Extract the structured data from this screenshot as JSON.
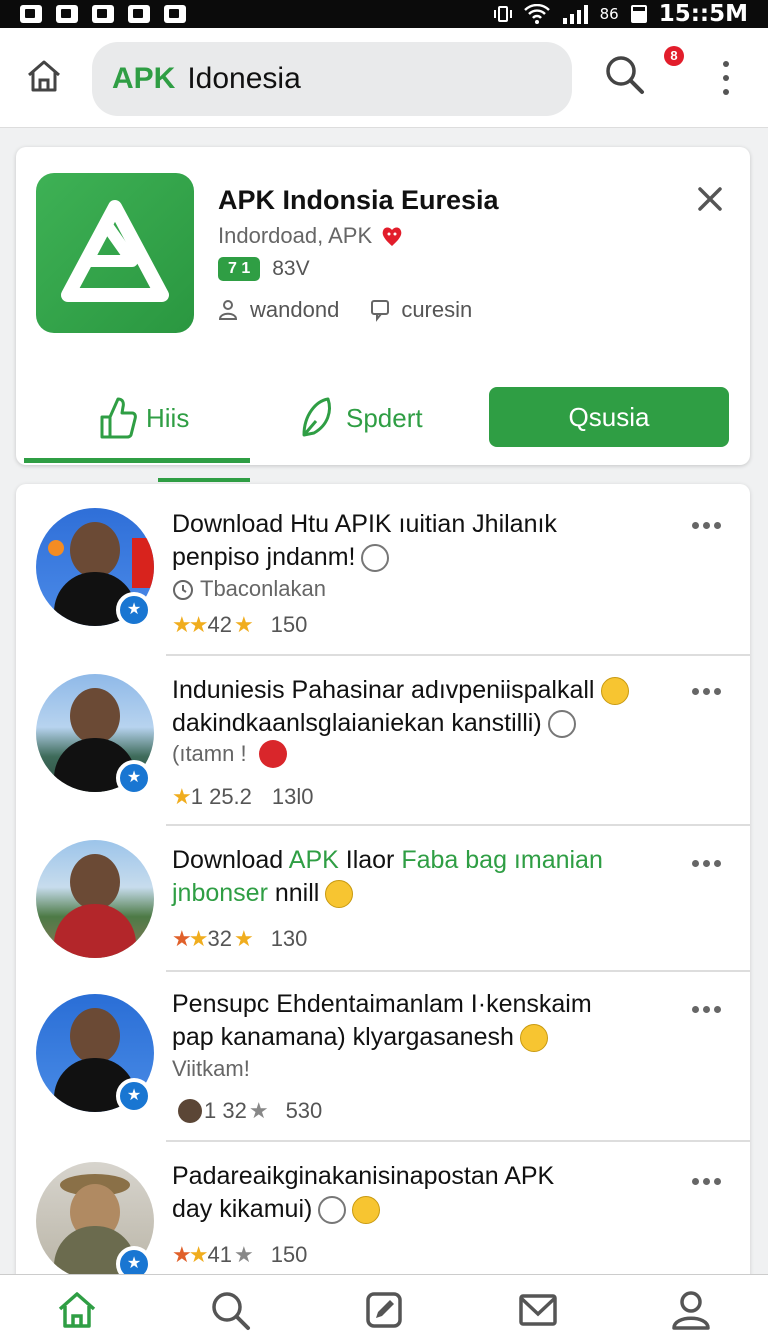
{
  "status_bar": {
    "battery": "86",
    "time": "15::5M"
  },
  "top_bar": {
    "brand": "APK",
    "search_text": "Idonesia"
  },
  "notification": {
    "count": "8"
  },
  "app_card": {
    "title": "APK  Indonsia Euresia",
    "subtitle": "Indordoad, APK",
    "rating_badge": "7 1",
    "rating_value": "83V",
    "meta_1": "wandond",
    "meta_2": "curesin",
    "tab_1": "Hiis",
    "tab_2": "Spdert",
    "install_label": "Qsusia"
  },
  "list_items": [
    {
      "title_line1": "Download Htu APIK ıuitian Jhilanık",
      "title_line2": "penpiso jndanm!",
      "sub": "Tbaconlakan",
      "stat_a": "42",
      "stat_b": "150"
    },
    {
      "title_line1": "Induniesis Pahasinar adıvpeniispalkall",
      "title_line2": "dakindkaanlsglaianiekan kanstilli)",
      "sub": "(ıtamn !",
      "stat_a": "1 25.2",
      "stat_b": "13l0"
    },
    {
      "title_part1": "Download",
      "title_part2": "APK",
      "title_part3": "Ilaor",
      "title_part4": "Faba bag ımanian",
      "title_line2": "jnbonser",
      "title_line2b": "nnill",
      "stat_a": "32",
      "stat_b": "130"
    },
    {
      "title_line1": "Pensupc Ehdentaimanlam I·kenskaim",
      "title_line2": "pap kanamana) klyargasanesh",
      "sub": "Viitkam!",
      "stat_a": "1 32",
      "stat_b": "530"
    },
    {
      "title_line1": "Padareaikginakanisinapostan APK",
      "title_line2": "day kikamui)",
      "stat_a": "41",
      "stat_b": "150"
    }
  ],
  "colors": {
    "accent": "#2f9e44",
    "verify": "#1976d2",
    "star": "#f0ad1e",
    "notif": "#e21d2b"
  }
}
